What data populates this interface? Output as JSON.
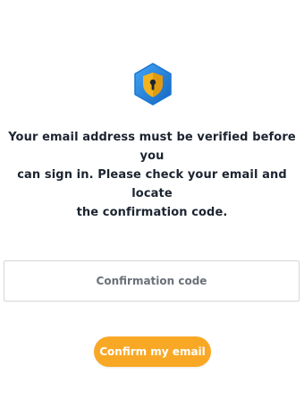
{
  "logo": {
    "icon": "shield-lock-icon"
  },
  "message": {
    "lines": [
      "Your email address must be verified before you",
      "can sign in. Please check your email and locate",
      "the confirmation code."
    ]
  },
  "confirmation_input": {
    "placeholder": "Confirmation code",
    "value": ""
  },
  "confirm_button": {
    "label": "Confirm my email"
  },
  "colors": {
    "accent": "#f9a825",
    "logo_blue": "#1e88e5",
    "logo_shield": "#f2b31f",
    "text": "#1c2430"
  }
}
